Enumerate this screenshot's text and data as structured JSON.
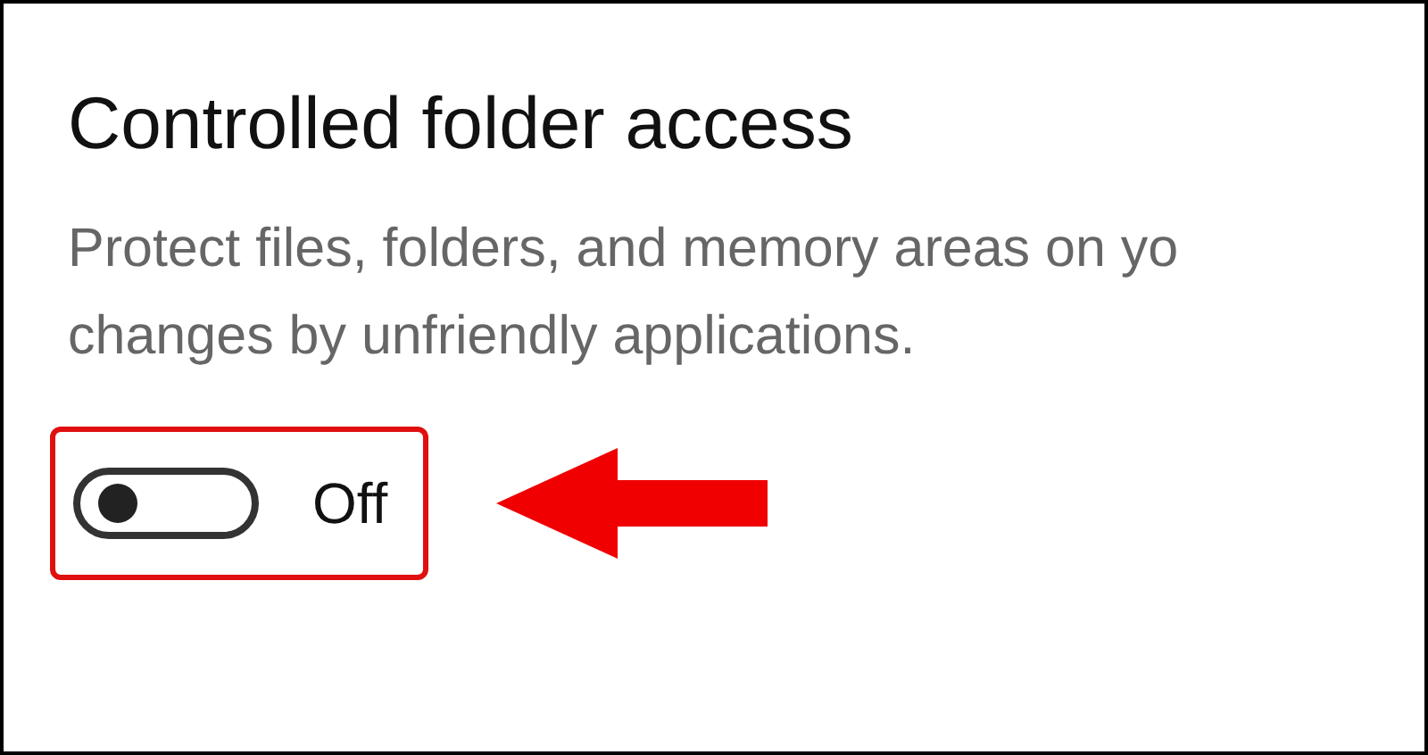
{
  "title": "Controlled folder access",
  "description": [
    "Protect files, folders, and memory areas on yo",
    "changes by unfriendly applications."
  ],
  "toggle": {
    "on": false,
    "label": "Off"
  }
}
